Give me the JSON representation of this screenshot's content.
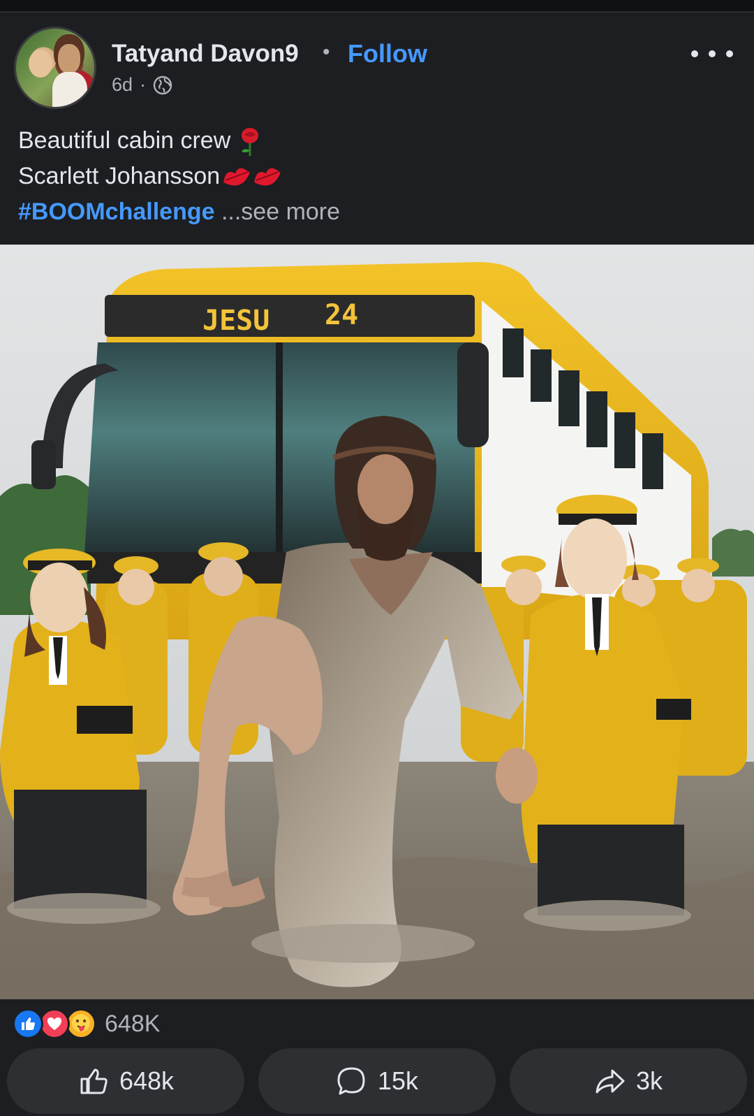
{
  "post": {
    "author": "Tatyand Davon9",
    "separator": "•",
    "follow_label": "Follow",
    "time": "6d",
    "meta_dot": "·",
    "audience_icon": "globe-icon",
    "more_icon": "more-horizontal-icon"
  },
  "caption": {
    "line1": "Beautiful cabin crew",
    "line2": "Scarlett Johansson",
    "hashtag": "#BOOMchallenge",
    "see_more": "...see more",
    "emoji1": "rose",
    "emoji2": "kiss-mark"
  },
  "image": {
    "bus_sign_left": "JESU",
    "bus_sign_right": "24",
    "description_colors": {
      "uniform": "#e0b01c",
      "sky": "#d7d9da",
      "water": "#7c7467"
    }
  },
  "reactions": {
    "icons": [
      "like",
      "love",
      "care"
    ],
    "count": "648K"
  },
  "actions": {
    "like_count": "648k",
    "comment_count": "15k",
    "share_count": "3k"
  },
  "colors": {
    "background": "#1c1e21",
    "link": "#4599ff",
    "button": "#2d2f33"
  }
}
